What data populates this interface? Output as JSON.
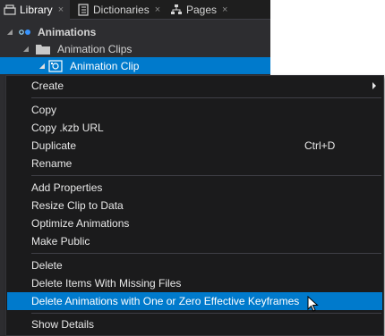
{
  "tabs": [
    {
      "label": "Library",
      "active": true,
      "close": "×"
    },
    {
      "label": "Dictionaries",
      "active": false,
      "close": "×"
    },
    {
      "label": "Pages",
      "active": false,
      "close": "×"
    }
  ],
  "tree": {
    "animations": "Animations",
    "animation_clips": "Animation Clips",
    "animation_clip": "Animation Clip"
  },
  "menu": {
    "create": "Create",
    "copy": "Copy",
    "copy_url": "Copy .kzb URL",
    "duplicate": "Duplicate",
    "duplicate_shortcut": "Ctrl+D",
    "rename": "Rename",
    "add_properties": "Add Properties",
    "resize_clip": "Resize Clip to Data",
    "optimize": "Optimize Animations",
    "make_public": "Make Public",
    "delete": "Delete",
    "delete_missing": "Delete Items With Missing Files",
    "delete_keyframes": "Delete Animations with One or Zero Effective Keyframes",
    "show_details": "Show Details"
  },
  "colors": {
    "accent": "#007acc",
    "panel_bg": "#2d2d30",
    "menu_bg": "#1b1b1c"
  }
}
